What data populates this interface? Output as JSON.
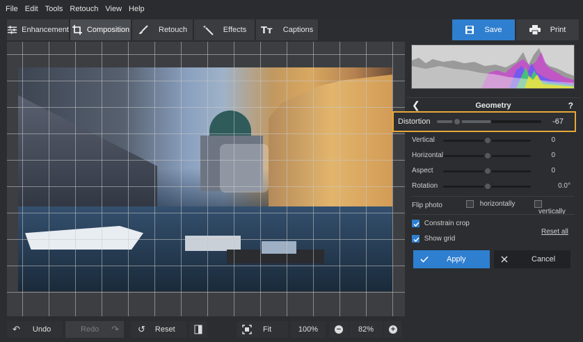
{
  "menu": [
    "File",
    "Edit",
    "Tools",
    "Retouch",
    "View",
    "Help"
  ],
  "tabs": [
    {
      "label": "Enhancement",
      "icon": "sliders-icon"
    },
    {
      "label": "Composition",
      "icon": "crop-icon"
    },
    {
      "label": "Retouch",
      "icon": "brush-icon"
    },
    {
      "label": "Effects",
      "icon": "magic-wand-icon"
    },
    {
      "label": "Captions",
      "icon": "text-icon"
    }
  ],
  "header": {
    "save": "Save",
    "print": "Print"
  },
  "geometry": {
    "title": "Geometry",
    "help": "?",
    "distortion": {
      "label": "Distortion",
      "value": "-67"
    },
    "vertical": {
      "label": "Vertical",
      "value": "0"
    },
    "horizontal": {
      "label": "Horizontal",
      "value": "0"
    },
    "aspect": {
      "label": "Aspect",
      "value": "0"
    },
    "rotation": {
      "label": "Rotation",
      "value": "0.0°"
    }
  },
  "flip": {
    "label": "Flip photo",
    "horizontally": "horizontally",
    "vertically": "vertically"
  },
  "options": {
    "constrain_crop": "Constrain crop",
    "show_grid": "Show grid",
    "reset_all": "Reset all"
  },
  "actions": {
    "apply": "Apply",
    "cancel": "Cancel"
  },
  "bottom": {
    "undo": "Undo",
    "redo": "Redo",
    "reset": "Reset",
    "fit": "Fit",
    "zoom_100": "100%",
    "zoom": "82%"
  },
  "colors": {
    "accent": "#2f7fd0",
    "highlight": "#e9a83a"
  }
}
